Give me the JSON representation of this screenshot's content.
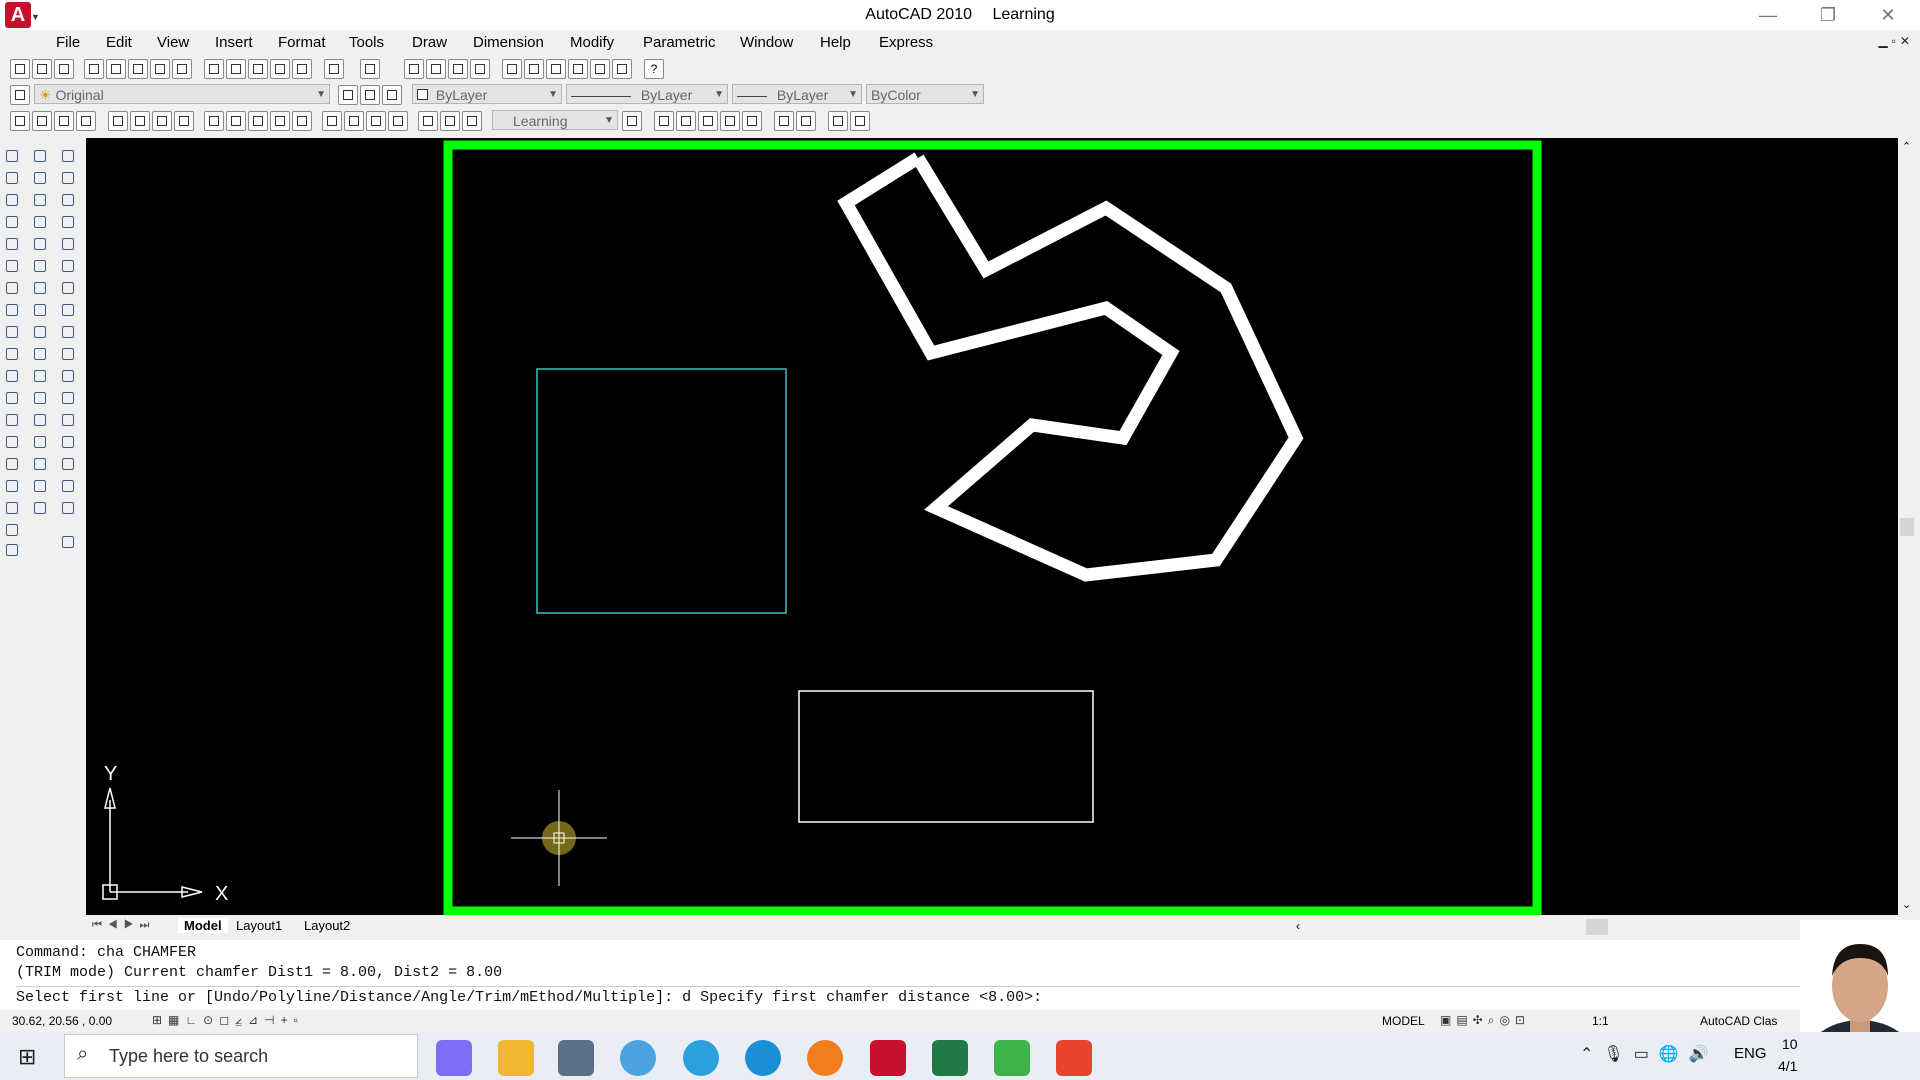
{
  "window": {
    "app_name": "AutoCAD 2010",
    "drawing_name": "Learning",
    "minimize": "—",
    "maximize": "❐",
    "close": "✕"
  },
  "menu": [
    "File",
    "Edit",
    "View",
    "Insert",
    "Format",
    "Tools",
    "Draw",
    "Dimension",
    "Modify",
    "Parametric",
    "Window",
    "Help",
    "Express"
  ],
  "properties": {
    "layer_state": "Original",
    "color": "ByLayer",
    "linetype": "ByLayer",
    "lineweight": "ByLayer",
    "plotstyle": "ByColor"
  },
  "dimstyle": "Learning",
  "drawing": {
    "frame_color": "#00ff00",
    "polyline_color": "#ffffff",
    "square_color": "#3fbfbf",
    "rect_color": "#ffffff",
    "ucs_x": "X",
    "ucs_y": "Y"
  },
  "layout_tabs": [
    "Model",
    "Layout1",
    "Layout2"
  ],
  "command_lines": [
    "Command: cha CHAMFER",
    "(TRIM mode) Current chamfer Dist1 = 8.00, Dist2 = 8.00",
    "Select first line or [Undo/Polyline/Distance/Angle/Trim/mEthod/Multiple]: d Specify first chamfer distance <8.00>:"
  ],
  "status": {
    "coords": "30.62, 20.56 , 0.00",
    "space": "MODEL",
    "annotation_scale": "1:1",
    "workspace": "AutoCAD Clas"
  },
  "taskbar": {
    "search_placeholder": "Type here to search",
    "language": "ENG",
    "time": "10",
    "date": "4/1"
  }
}
